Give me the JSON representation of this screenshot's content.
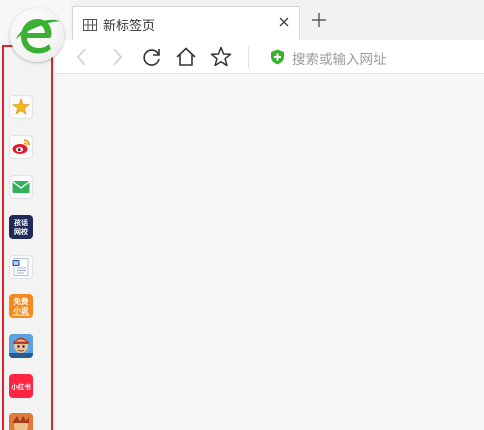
{
  "browser": {
    "logo_icon": "360-browser-e-logo",
    "brand_color": "#3cb034"
  },
  "tab": {
    "title": "新标签页",
    "icon": "grid-icon",
    "close_icon": "close-icon"
  },
  "new_tab_icon": "plus-icon",
  "toolbar": {
    "back_icon": "back-arrow-icon",
    "forward_icon": "forward-arrow-icon",
    "refresh_icon": "refresh-icon",
    "home_icon": "home-icon",
    "favorite_icon": "star-outline-icon"
  },
  "address_bar": {
    "placeholder": "搜索或输入网址",
    "security_icon": "green-shield-plus-icon"
  },
  "sidebar": {
    "highlight_color": "#d9252b",
    "items": [
      {
        "name": "favorites",
        "icon": "star-icon",
        "label": ""
      },
      {
        "name": "weibo",
        "icon": "weibo-icon",
        "label": ""
      },
      {
        "name": "mail",
        "icon": "mail-icon",
        "label": ""
      },
      {
        "name": "tuanjie-wangxiao",
        "icon": "tuanjie-icon",
        "label": "孩话\n网校"
      },
      {
        "name": "word-document",
        "icon": "document-icon",
        "label": "W"
      },
      {
        "name": "free-novel",
        "icon": "novel-icon",
        "label": "免费\n小说"
      },
      {
        "name": "game",
        "icon": "game-icon",
        "label": ""
      },
      {
        "name": "xiaohongshu",
        "icon": "xiaohongshu-icon",
        "label": "小红书"
      },
      {
        "name": "game-2",
        "icon": "game-icon-2",
        "label": ""
      }
    ]
  }
}
